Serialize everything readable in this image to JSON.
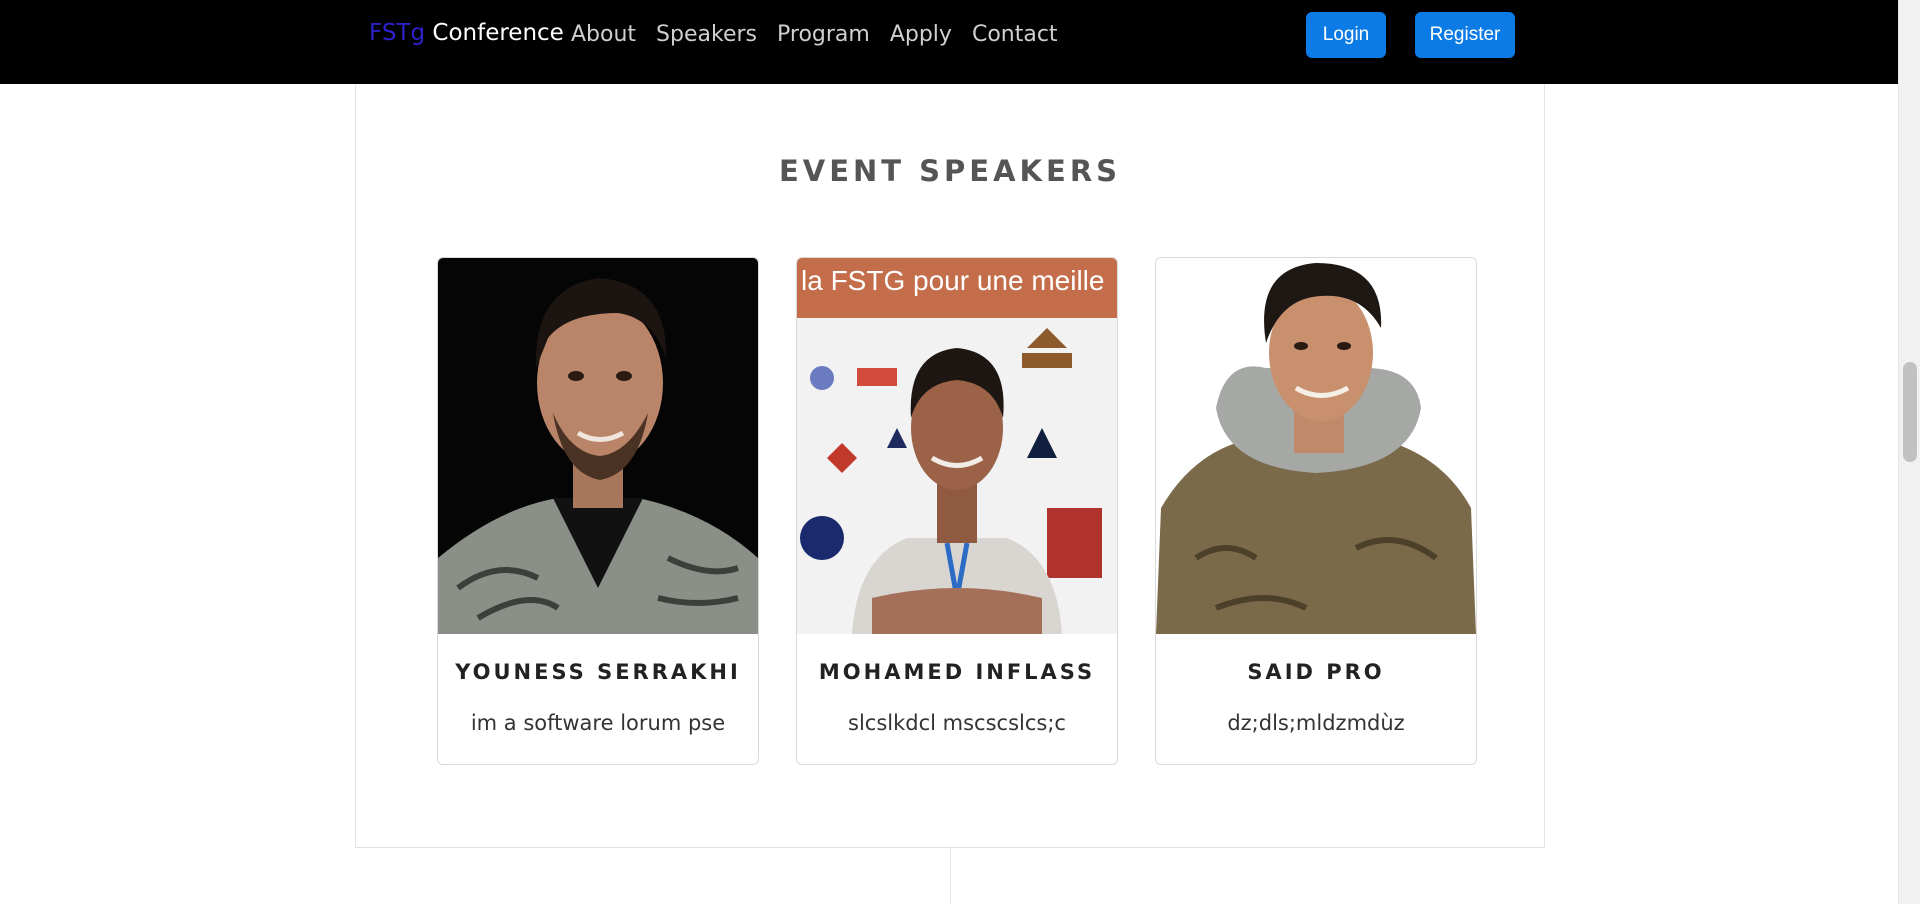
{
  "navbar": {
    "brand_accent": "FSTg",
    "brand_rest": " Conference",
    "links": [
      "About",
      "Speakers",
      "Program",
      "Apply",
      "Contact"
    ],
    "login_label": "Login",
    "register_label": "Register"
  },
  "section": {
    "title": "EVENT SPEAKERS"
  },
  "speakers": [
    {
      "name": "YOUNESS SERRAKHI",
      "description": "im a software lorum pse",
      "photo_icon": "person-photo"
    },
    {
      "name": "MOHAMED INFLASS",
      "description": "slcslkdcl mscscslcs;c",
      "photo_icon": "person-photo",
      "banner_text": "la FSTG pour une meille"
    },
    {
      "name": "SAID PRO",
      "description": "dz;dls;mldzmdùz",
      "photo_icon": "person-photo"
    }
  ],
  "colors": {
    "navbar_bg": "#000000",
    "brand_accent": "#2d22c9",
    "button_bg": "#0d7be6",
    "title_color": "#555555"
  }
}
